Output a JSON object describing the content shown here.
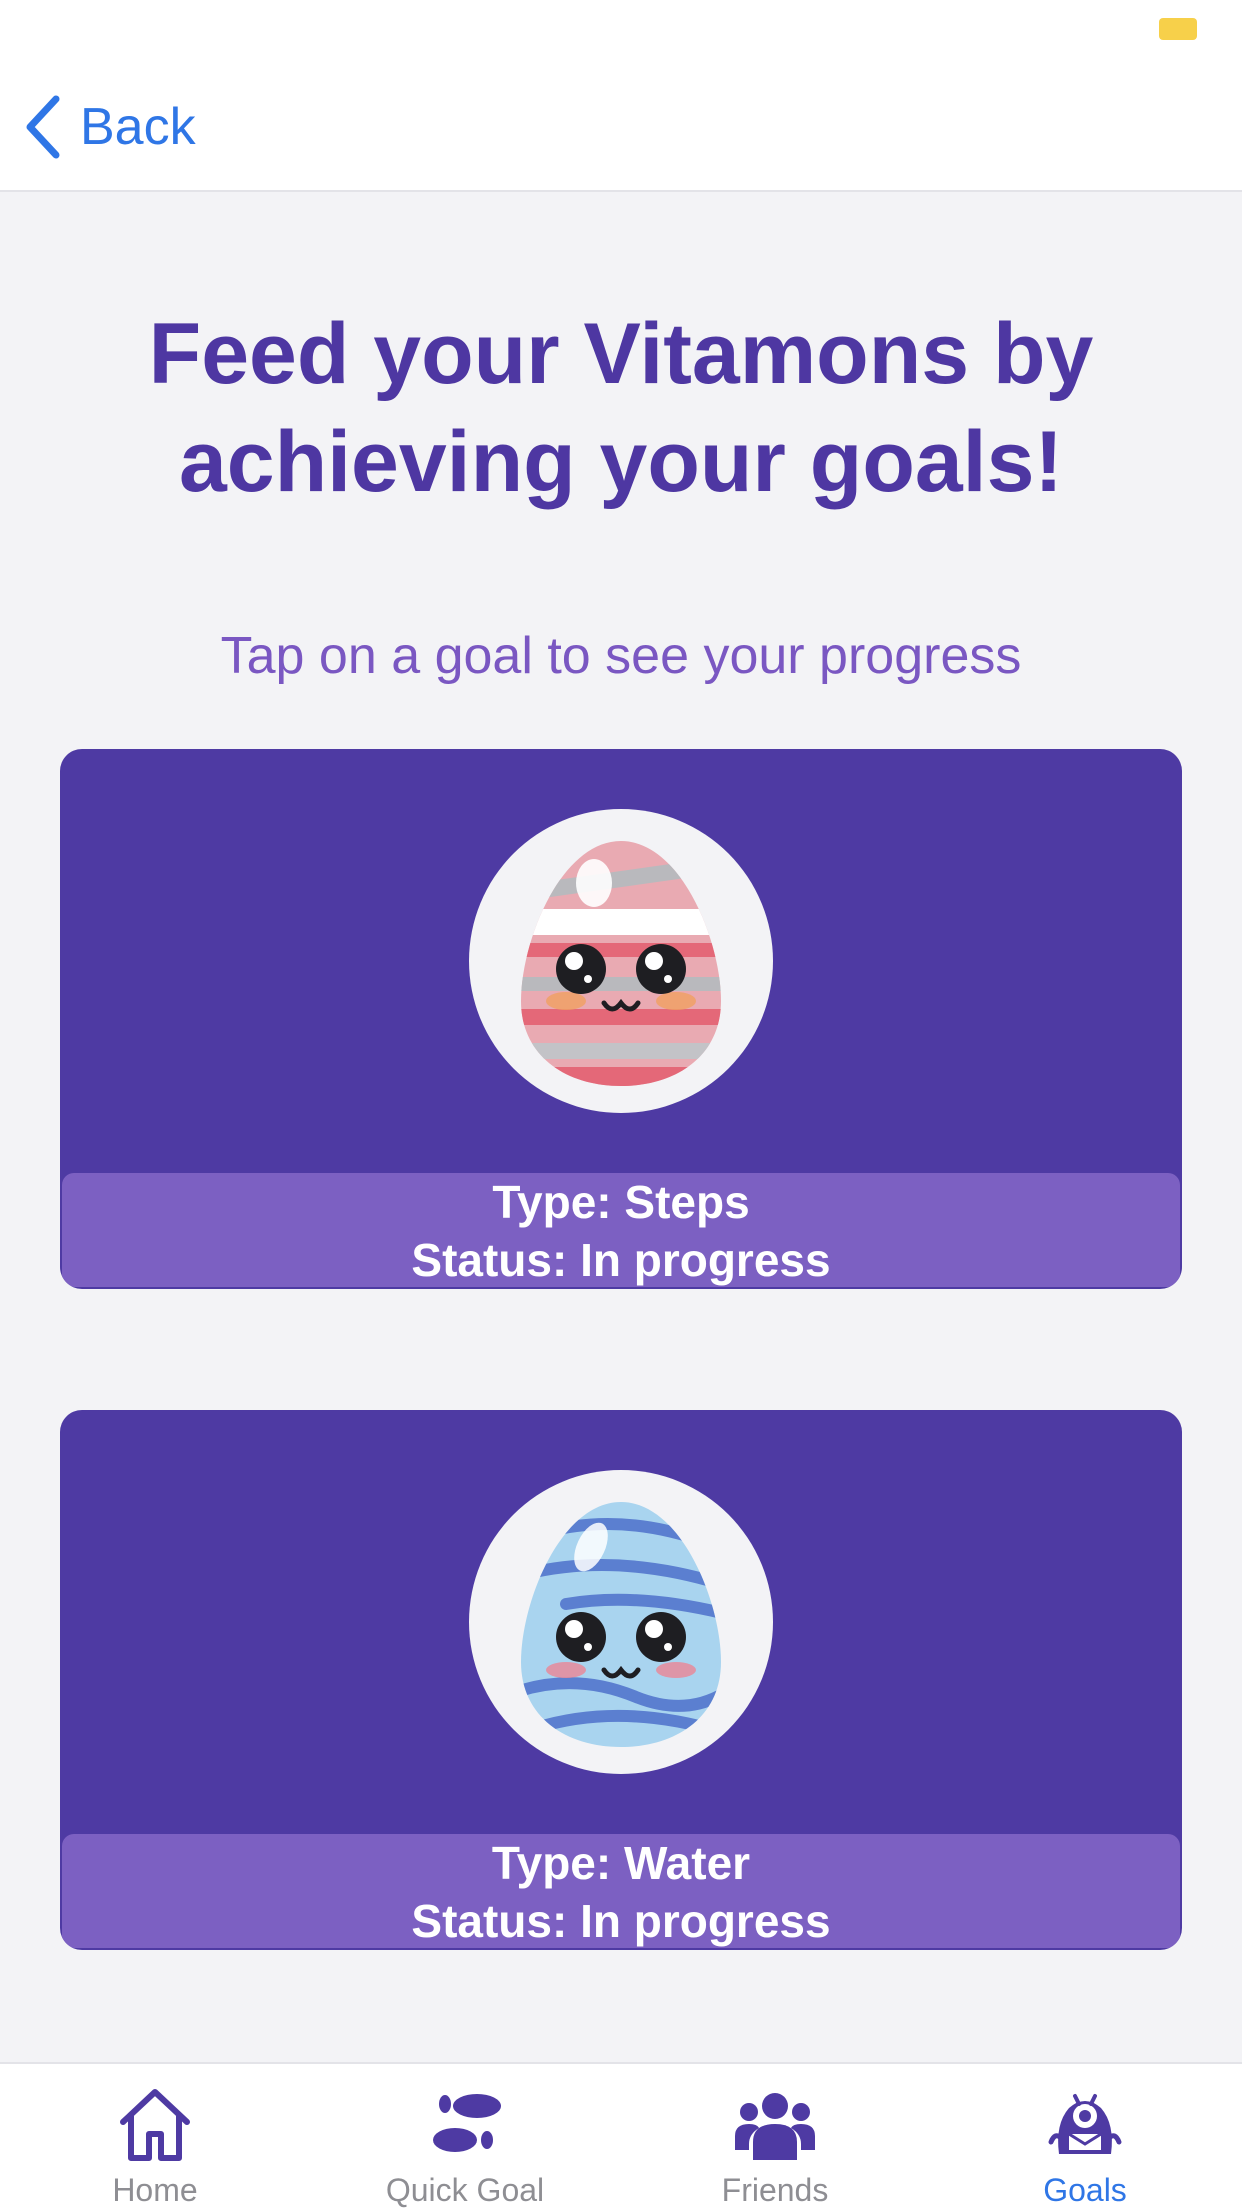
{
  "nav": {
    "back_label": "Back"
  },
  "main": {
    "headline": "Feed your Vitamons by achieving your goals!",
    "subtitle": "Tap on a goal to see your progress",
    "goals": [
      {
        "type_text": "Type: Steps",
        "status_text": "Status: In progress",
        "egg_icon": "pink-egg-icon"
      },
      {
        "type_text": "Type: Water",
        "status_text": "Status: In progress",
        "egg_icon": "blue-egg-icon"
      }
    ]
  },
  "tabs": [
    {
      "label": "Home",
      "icon": "home-icon",
      "active": false
    },
    {
      "label": "Quick Goal",
      "icon": "footprints-icon",
      "active": false
    },
    {
      "label": "Friends",
      "icon": "group-icon",
      "active": false
    },
    {
      "label": "Goals",
      "icon": "monster-icon",
      "active": true
    }
  ],
  "colors": {
    "primary_purple": "#4e3aa3",
    "light_purple": "#7c60c2",
    "accent_blue": "#2f76e6",
    "background": "#f3f3f6"
  }
}
